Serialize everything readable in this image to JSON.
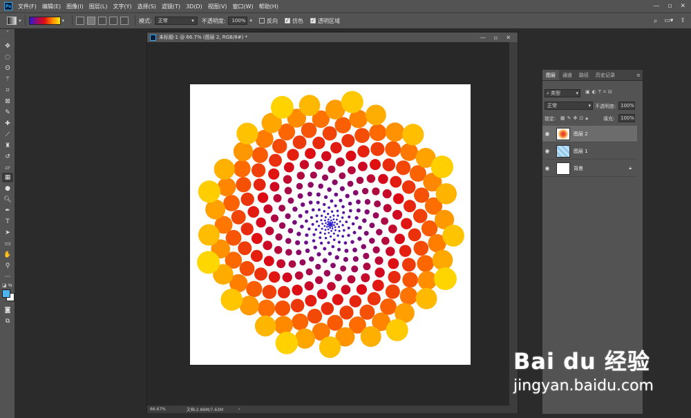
{
  "menubar": {
    "logo": "Ps",
    "items": [
      "文件(F)",
      "编辑(E)",
      "图像(I)",
      "图层(L)",
      "文字(Y)",
      "选择(S)",
      "滤镜(T)",
      "3D(D)",
      "视图(V)",
      "窗口(W)",
      "帮助(H)"
    ],
    "controls": [
      "—",
      "▫",
      "✕"
    ]
  },
  "options": {
    "mode_label": "模式:",
    "mode_value": "正常",
    "opacity_label": "不透明度:",
    "opacity_value": "100%",
    "reverse_label": "反向",
    "dither_label": "仿色",
    "transparency_label": "透明区域",
    "reverse_checked": false,
    "dither_checked": true,
    "transparency_checked": true
  },
  "document": {
    "title": "未标题-1 @ 66.7% (图层 2, RGB/8#) *",
    "zoom": "66.67%",
    "doc_info": "文档:2.86M/7.63M"
  },
  "tools": [
    "move-icon",
    "marquee-icon",
    "lasso-icon",
    "magic-wand-icon",
    "crop-icon",
    "frame-icon",
    "eyedropper-icon",
    "healing-icon",
    "brush-icon",
    "stamp-icon",
    "history-brush-icon",
    "eraser-icon",
    "gradient-icon",
    "blur-icon",
    "dodge-icon",
    "pen-icon",
    "type-icon",
    "path-select-icon",
    "rectangle-icon",
    "hand-icon",
    "zoom-icon",
    "more-icon"
  ],
  "colors": {
    "foreground": "#4fb3ec",
    "background": "#ffffff"
  },
  "layers_panel": {
    "tabs": [
      "图层",
      "通道",
      "路径",
      "历史记录"
    ],
    "filter_label": "类型",
    "blend_mode": "正常",
    "opacity_label": "不透明度:",
    "opacity_value": "100%",
    "lock_label": "锁定:",
    "fill_label": "填充:",
    "fill_value": "100%",
    "layers": [
      {
        "name": "图层 2",
        "selected": true
      },
      {
        "name": "图层 1",
        "selected": false
      },
      {
        "name": "背景",
        "selected": false,
        "locked": true
      }
    ]
  },
  "watermark": {
    "brand": "Bai du 经验",
    "url": "jingyan.baidu.com"
  }
}
